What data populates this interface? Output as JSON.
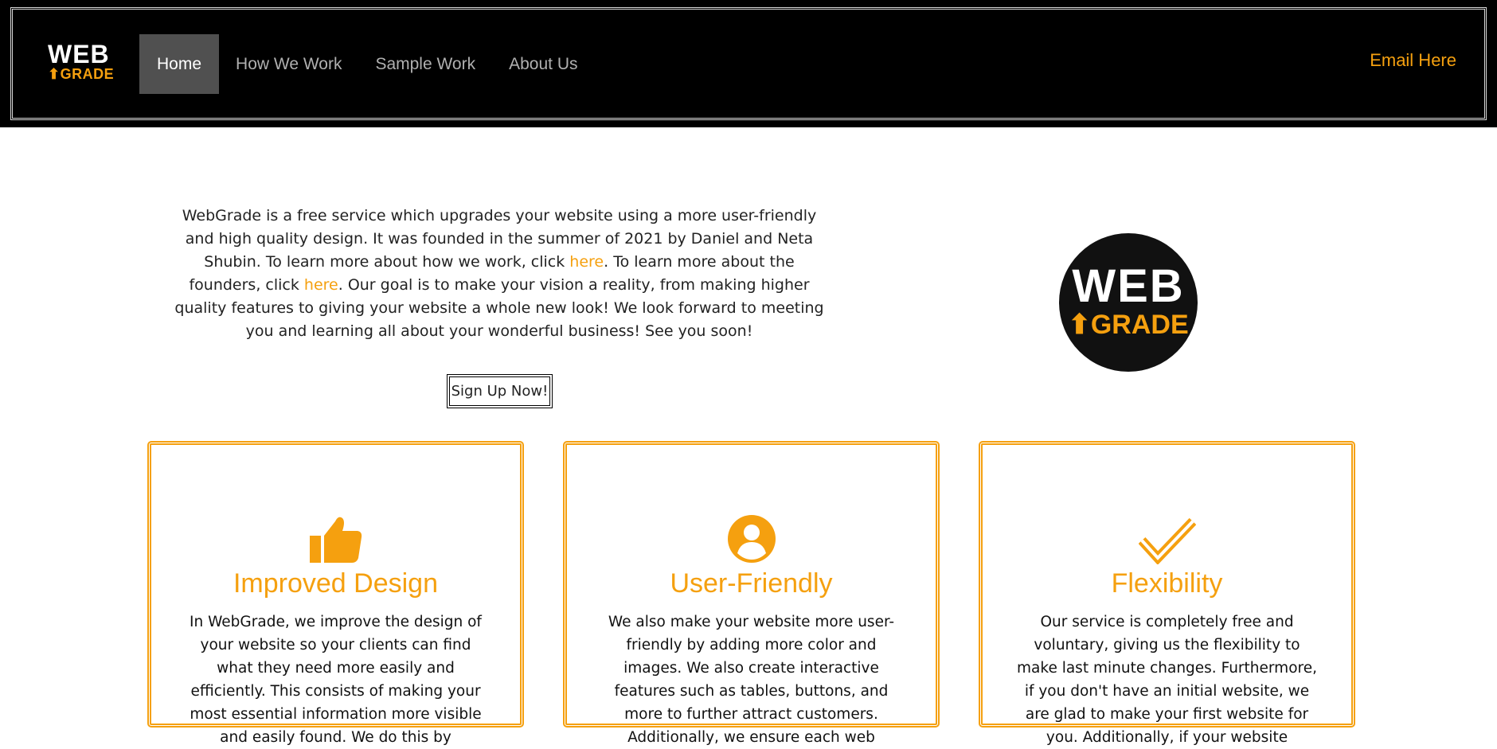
{
  "header": {
    "logo": {
      "word1": "WEB",
      "word2": "⬆GRADE"
    },
    "nav": [
      {
        "label": "Home",
        "active": true
      },
      {
        "label": "How We Work",
        "active": false
      },
      {
        "label": "Sample Work",
        "active": false
      },
      {
        "label": "About Us",
        "active": false
      }
    ],
    "email_label": "Email Here"
  },
  "intro": {
    "p1": "WebGrade is a free service which upgrades your website using a more user-friendly and high quality design. It was founded in the summer of 2021 by Daniel and Neta Shubin. To learn more about how we work, click ",
    "link1": "here",
    "p2": ". To learn more about the founders, click ",
    "link2": "here",
    "p3": ". Our goal is to make your vision a reality, from making higher quality features to giving your website a whole new look! We look forward to meeting you and learning all about your wonderful business! See you soon!",
    "signup_label": "Sign Up Now!"
  },
  "badge": {
    "word1": "WEB",
    "word2": "⬆GRADE"
  },
  "cards": [
    {
      "icon": "thumbs-up-icon",
      "title": "Improved Design",
      "text": "In WebGrade, we improve the design of your website so your clients can find what they need more easily and efficiently. This consists of making your most essential information more visible and easily found. We do this by"
    },
    {
      "icon": "user-circle-icon",
      "title": "User-Friendly",
      "text": "We also make your website more user-friendly by adding more color and images. We also create interactive features such as tables, buttons, and more to further attract customers. Additionally, we ensure each web"
    },
    {
      "icon": "check-icon",
      "title": "Flexibility",
      "text": "Our service is completely free and voluntary, giving us the flexibility to make last minute changes. Furthermore, if you don't have an initial website, we are glad to make your first website for you. Additionally, if your website"
    }
  ],
  "colors": {
    "accent": "#f5a00f",
    "header_bg": "#000000",
    "nav_active_bg": "#505050",
    "badge_bg": "#111111"
  }
}
